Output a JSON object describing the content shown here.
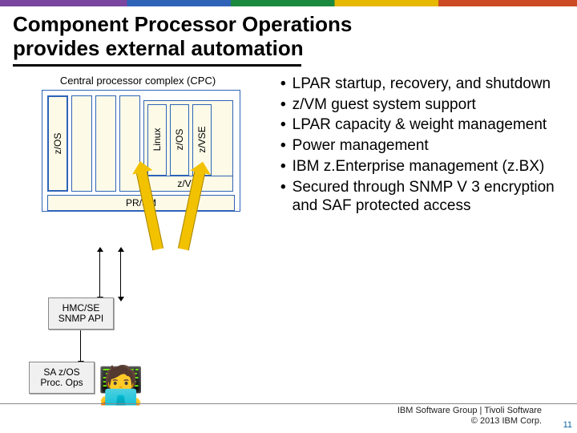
{
  "title": "Component Processor Operations\nprovides external automation",
  "diagram": {
    "cpc_label": "Central processor complex (CPC)",
    "partitions": {
      "left": "z/OS",
      "zvm_guests": [
        "Linux",
        "z/OS",
        "z/VSE"
      ],
      "zvm_label": "z/VM"
    },
    "prsm": "PR/SM",
    "hmc_node": "HMC/SE\nSNMP API",
    "sa_node": "SA z/OS\nProc. Ops"
  },
  "bullets": [
    "LPAR startup, recovery, and shutdown",
    "z/VM guest system support",
    "LPAR capacity & weight management",
    "Power management",
    "IBM z.Enterprise management (z.BX)",
    "Secured through SNMP V 3 encryption and SAF protected  access"
  ],
  "footer": {
    "line1": "IBM Software Group | Tivoli Software",
    "line2": "© 2013 IBM Corp."
  },
  "page_number": "11"
}
